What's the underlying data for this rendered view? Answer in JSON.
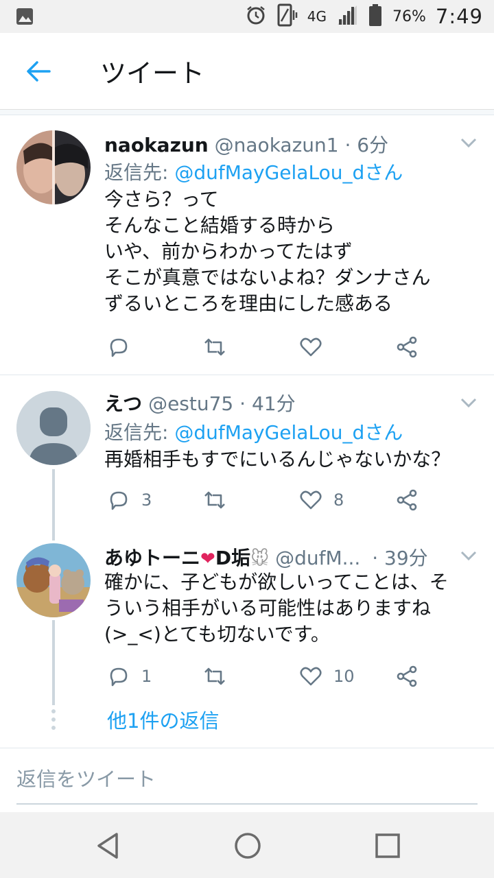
{
  "status_bar": {
    "network": "4G",
    "battery_percent": "76%",
    "time": "7:49",
    "icons": [
      "image-icon",
      "alarm-icon",
      "vibrate-icon",
      "signal-icon",
      "battery-icon"
    ]
  },
  "app_bar": {
    "back_icon": "arrow-left-icon",
    "title": "ツイート"
  },
  "tweets": [
    {
      "name": "naokazun",
      "handle": "@naokazun1",
      "time": "· 6分",
      "reply_prefix": "返信先: ",
      "reply_to": "@dufMayGelaLou_dさん",
      "text": "今さら？って\nそんなこと結婚する時から\nいや、前からわかってたはず\nそこが真意ではないよね？ダンナさん\nずるいところを理由にした感ある",
      "reply_count": "",
      "retweet_count": "",
      "like_count": ""
    },
    {
      "name": "えつ",
      "handle": "@estu75",
      "time": "· 41分",
      "reply_prefix": "返信先: ",
      "reply_to": "@dufMayGelaLou_dさん",
      "text": "再婚相手もすでにいるんじゃないかな？",
      "reply_count": "3",
      "retweet_count": "",
      "like_count": "8"
    },
    {
      "name": "あゆトーニ",
      "name_suffix": "D垢",
      "handle": "@dufM...",
      "time": "· 39分",
      "text": "確かに、子どもが欲しいってことは、そ\nういう相手がいる可能性はありますね\n(>_<)とても切ないです。",
      "reply_count": "1",
      "retweet_count": "",
      "like_count": "10"
    }
  ],
  "more_replies": "他1件の返信",
  "composer": {
    "placeholder": "返信をツイート"
  },
  "colors": {
    "accent": "#1da1f2",
    "secondary_text": "#657786",
    "thread_line": "#ccd6dd"
  }
}
